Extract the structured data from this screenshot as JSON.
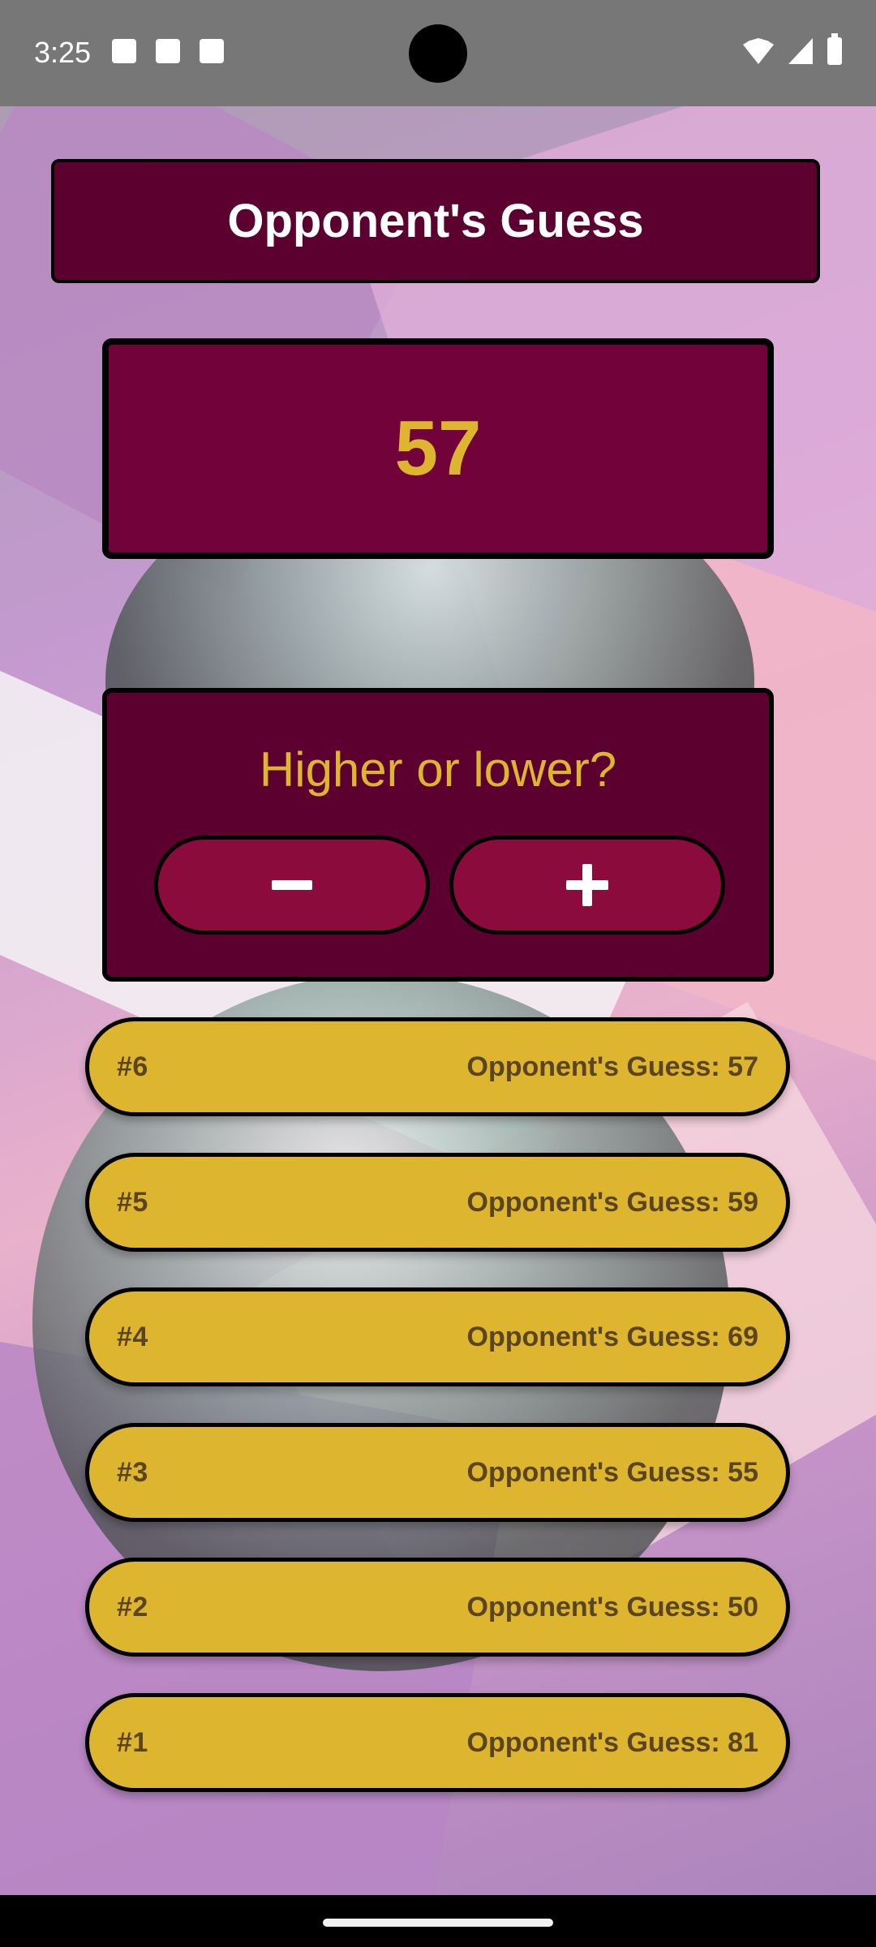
{
  "status_bar": {
    "time": "3:25",
    "icons": [
      "shield-play-icon",
      "sd-card-icon",
      "font-a-icon"
    ],
    "right_icons": [
      "wifi-icon",
      "signal-icon",
      "battery-icon"
    ]
  },
  "header": {
    "title": "Opponent's Guess"
  },
  "current_guess": "57",
  "controls": {
    "prompt": "Higher or lower?",
    "lower_icon": "minus-icon",
    "higher_icon": "plus-icon"
  },
  "guess_log": [
    {
      "round": "#6",
      "text": "Opponent's Guess: 57"
    },
    {
      "round": "#5",
      "text": "Opponent's Guess: 59"
    },
    {
      "round": "#4",
      "text": "Opponent's Guess: 69"
    },
    {
      "round": "#3",
      "text": "Opponent's Guess: 55"
    },
    {
      "round": "#2",
      "text": "Opponent's Guess: 50"
    },
    {
      "round": "#1",
      "text": "Opponent's Guess: 81"
    }
  ],
  "colors": {
    "primary_dark": "#5c0030",
    "primary": "#72033a",
    "button": "#8c0b3d",
    "accent": "#ddb52f",
    "log_text": "#5a4520"
  }
}
